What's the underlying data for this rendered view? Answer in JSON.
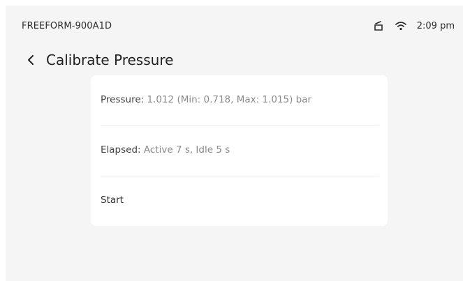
{
  "status_bar": {
    "device_name": "FREEFORM-900A1D",
    "time": "2:09 pm",
    "icons": [
      "device-icon",
      "wifi-icon"
    ]
  },
  "header": {
    "back_icon": "chevron-left-icon",
    "title": "Calibrate Pressure"
  },
  "card": {
    "pressure": {
      "label": "Pressure:",
      "value": "1.012 (Min: 0.718, Max: 1.015) bar"
    },
    "elapsed": {
      "label": "Elapsed:",
      "value": "Active 7 s, Idle 5 s"
    },
    "start": {
      "label": "Start"
    }
  }
}
